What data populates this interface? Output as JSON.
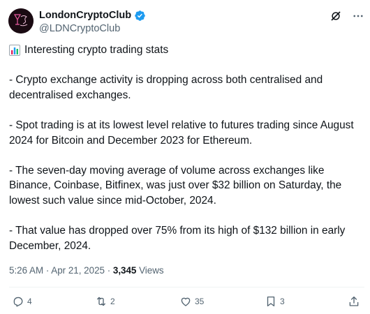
{
  "author": {
    "display_name": "LondonCryptoClub",
    "handle": "@LDNCryptoClub",
    "verified": true,
    "avatar_text": "London Crypto Club"
  },
  "post": {
    "intro": "Interesting crypto trading stats",
    "paragraphs": [
      "- Crypto exchange activity is dropping across both centralised and decentralised exchanges.",
      "- Spot trading is at its lowest level relative to futures trading since August 2024 for Bitcoin and December 2023 for Ethereum.",
      "- The seven-day moving average of volume across exchanges like Binance, Coinbase, Bitfinex, was just over $32 billion on Saturday, the lowest such value since mid-October, 2024.",
      "- That value has dropped over 75% from its high of $132 billion in early December, 2024."
    ]
  },
  "meta": {
    "timestamp": "5:26 AM · Apr 21, 2025 · ",
    "views_count": "3,345",
    "views_label": " Views"
  },
  "actions": {
    "replies": "4",
    "reposts": "2",
    "likes": "35",
    "bookmarks": "3"
  },
  "colors": {
    "verified": "#1d9bf0",
    "muted": "#536471",
    "text": "#0f1419"
  },
  "icons": [
    "grok-icon",
    "more-icon",
    "bar-chart-emoji-icon",
    "reply-icon",
    "repost-icon",
    "like-icon",
    "bookmark-icon",
    "share-icon"
  ]
}
